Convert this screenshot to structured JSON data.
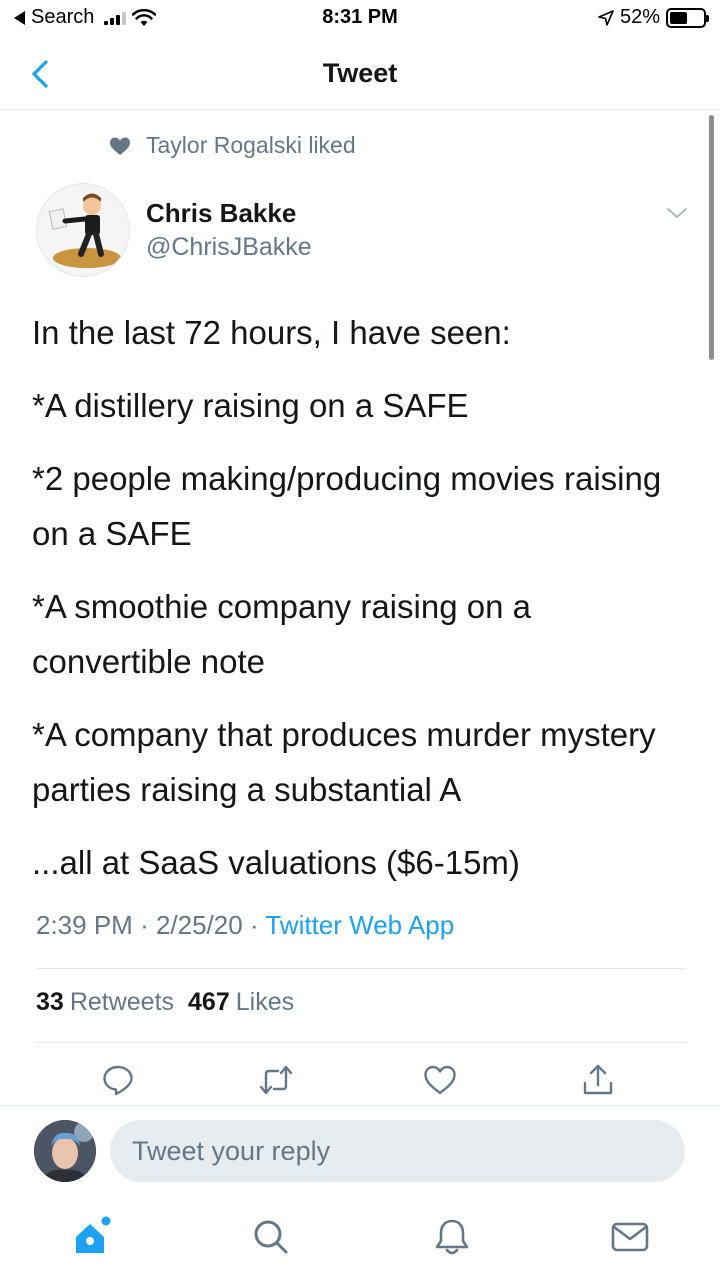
{
  "status_bar": {
    "back_app": "Search",
    "time": "8:31 PM",
    "battery": "52%",
    "battery_level": 0.52
  },
  "nav": {
    "title": "Tweet"
  },
  "social_context": {
    "text": "Taylor Rogalski liked"
  },
  "tweet": {
    "author_name": "Chris Bakke",
    "author_handle": "@ChrisJBakke",
    "paragraphs": [
      "In the last 72 hours, I have seen:",
      "*A distillery raising on a SAFE",
      "*2 people making/producing movies raising on a SAFE",
      "*A smoothie company raising on a convertible note",
      "*A company that produces murder mystery parties raising a substantial A",
      "...all at SaaS valuations ($6-15m)"
    ],
    "time": "2:39 PM",
    "date": "2/25/20",
    "source": "Twitter Web App",
    "retweets_count": "33",
    "retweets_label": "Retweets",
    "likes_count": "467",
    "likes_label": "Likes"
  },
  "reply": {
    "placeholder": "Tweet your reply"
  },
  "icons": {
    "accent": "#1da1f2",
    "muted": "#657786"
  }
}
